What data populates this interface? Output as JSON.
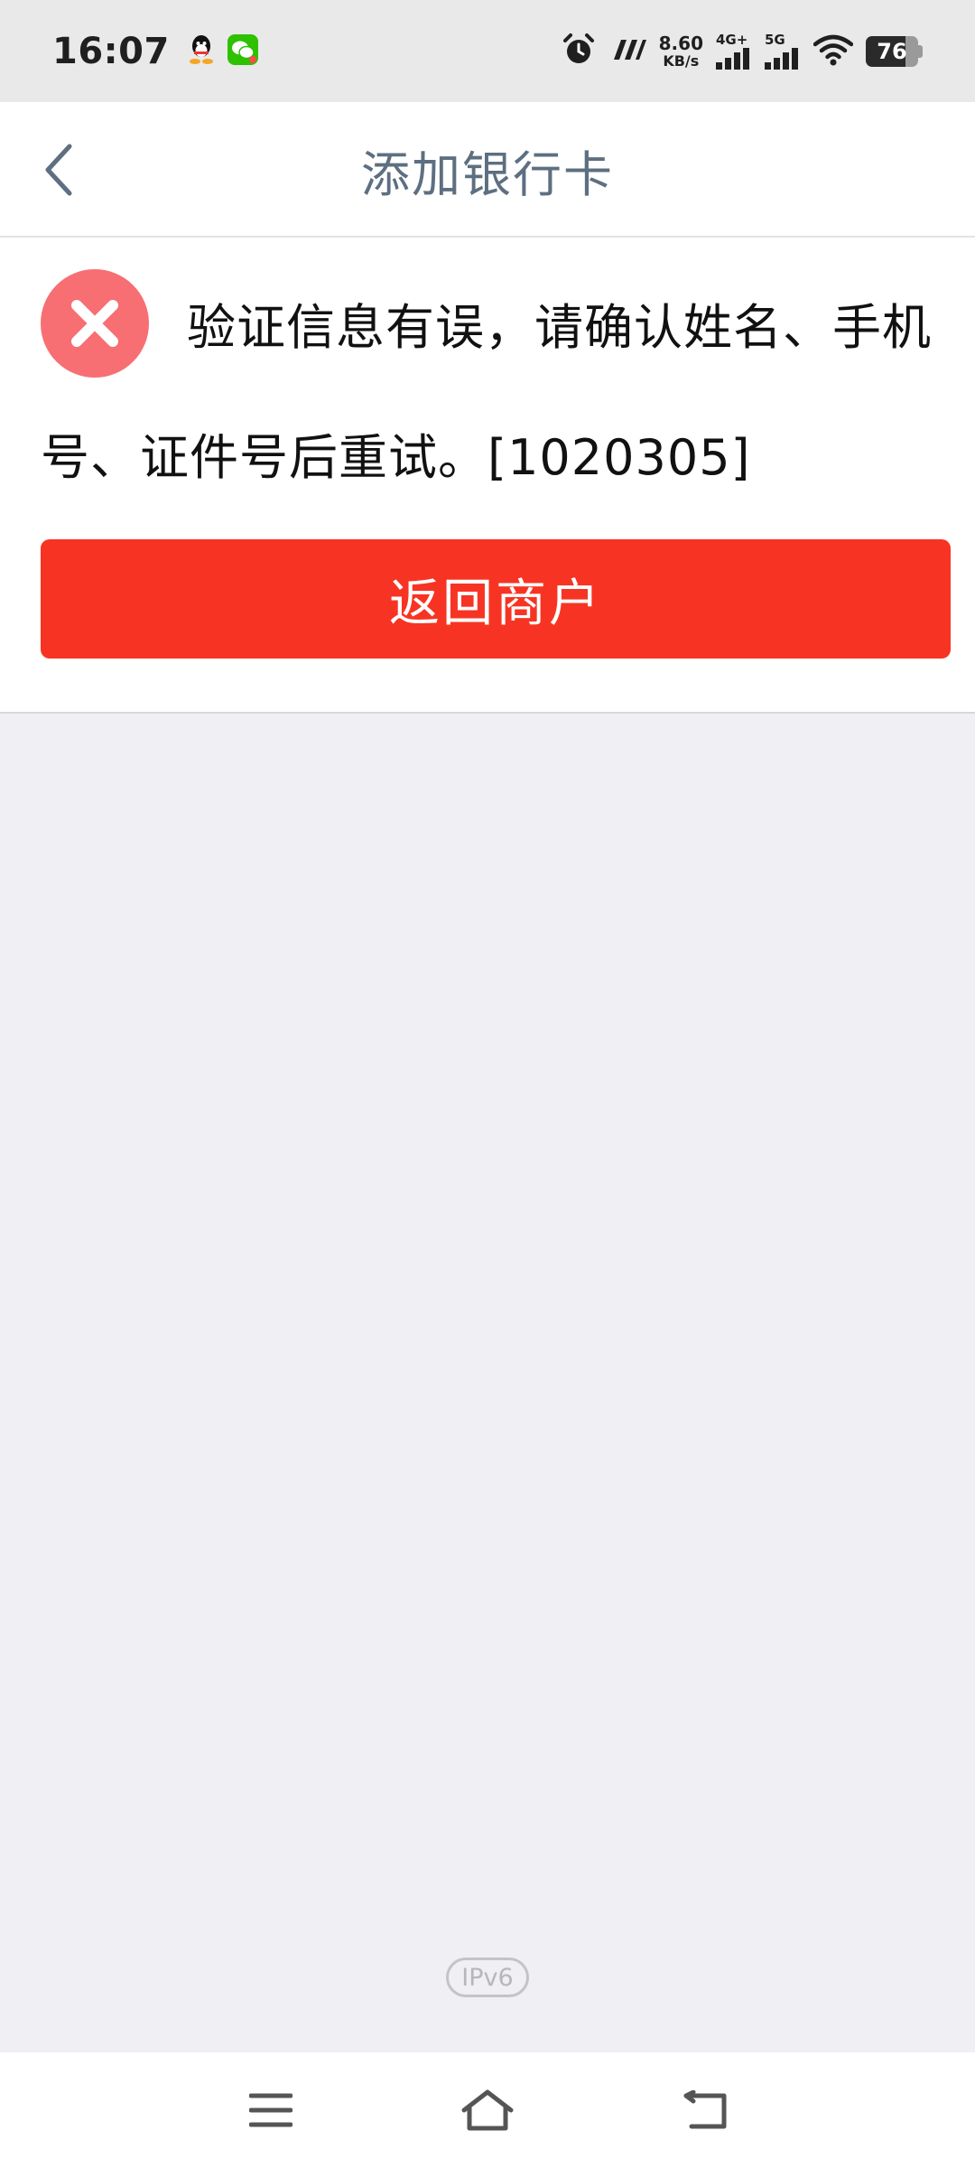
{
  "status_bar": {
    "time": "16:07",
    "net_speed_value": "8.60",
    "net_speed_unit": "KB/s",
    "signal1_label": "4G+",
    "signal2_label": "5G",
    "battery": "76",
    "icons": [
      "qq-icon",
      "wechat-icon",
      "alarm-icon",
      "hd-icon",
      "signal-icon",
      "wifi-icon",
      "battery-icon"
    ]
  },
  "header": {
    "title": "添加银行卡"
  },
  "error": {
    "message": "验证信息有误，请确认姓名、手机号、证件号后重试。[1020305]",
    "color": "#f76f73"
  },
  "actions": {
    "return_label": "返回商户",
    "color": "#f73423"
  },
  "footer": {
    "ipv6_label": "IPv6"
  }
}
